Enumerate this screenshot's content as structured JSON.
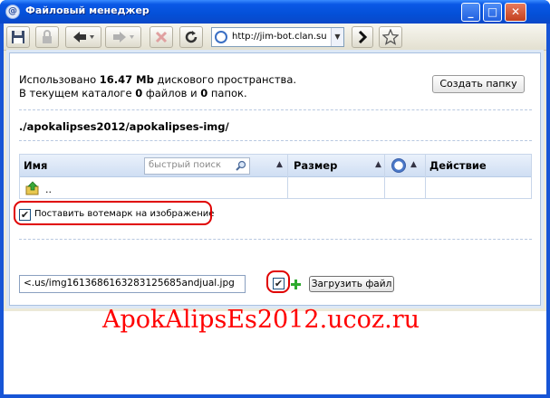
{
  "window": {
    "title": "Файловый менеджер",
    "title_icon_glyph": "@",
    "minimize_glyph": "_",
    "maximize_glyph": "□",
    "close_glyph": "✕"
  },
  "toolbar": {
    "url": "http://jim-bot.clan.su",
    "icons": [
      "save-icon",
      "lock-icon",
      "back-icon",
      "forward-icon",
      "stop-icon",
      "reload-icon",
      "go-icon",
      "bookmark-star-icon"
    ]
  },
  "info": {
    "prefix": "Использовано ",
    "used": "16.47 Mb",
    "suffix": " дискового пространства.",
    "line2_prefix": "В текущем каталоге ",
    "files": "0",
    "files_label": " файлов и ",
    "folders": "0",
    "folders_label": " папок."
  },
  "create_folder_label": "Создать папку",
  "path": "./apokalipses2012/apokalipses-img/",
  "table": {
    "col_name": "Имя",
    "search_placeholder": "быстрый поиск",
    "col_size": "Размер",
    "col_action": "Действие",
    "up_label": ".."
  },
  "watermark_option": {
    "label": "Поставить вотемарк на изображение",
    "checked": true
  },
  "upload": {
    "file_value": "<.us/img1613686163283125685andjual.jpg",
    "checked": true,
    "button_label": "Загрузить файл"
  },
  "overlay_text": "ApokAlipsEs2012.ucoz.ru",
  "colors": {
    "titlebar": "#0450d8",
    "highlight_ring": "#e00000",
    "overlay_text": "#ff0000"
  }
}
